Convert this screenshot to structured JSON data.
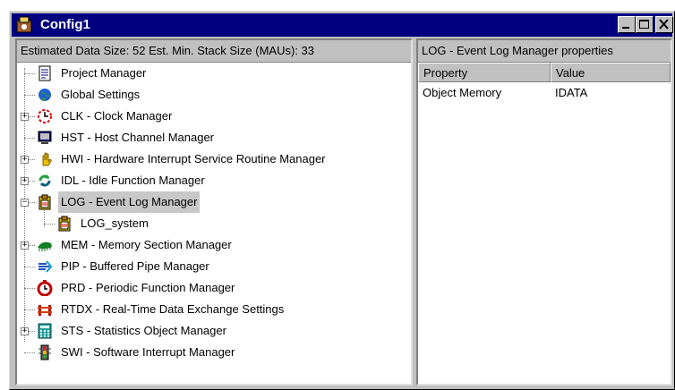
{
  "window": {
    "title": "Config1",
    "controls": {
      "minimize": "minimize",
      "maximize": "maximize",
      "close": "close"
    }
  },
  "left_pane": {
    "header": "Estimated Data Size: 52   Est. Min. Stack Size (MAUs): 33",
    "tree": [
      {
        "label": "Project Manager",
        "icon": "project-manager-icon",
        "expandable": false
      },
      {
        "label": "Global Settings",
        "icon": "globe-icon",
        "expandable": false
      },
      {
        "label": "CLK - Clock Manager",
        "icon": "clock-icon",
        "expandable": true,
        "expanded": false
      },
      {
        "label": "HST - Host Channel Manager",
        "icon": "monitor-icon",
        "expandable": false
      },
      {
        "label": "HWI - Hardware Interrupt Service Routine Manager",
        "icon": "hand-icon",
        "expandable": true,
        "expanded": false
      },
      {
        "label": "IDL - Idle Function Manager",
        "icon": "idle-loop-icon",
        "expandable": true,
        "expanded": false
      },
      {
        "label": "LOG - Event Log Manager",
        "icon": "log-clipboard-icon",
        "expandable": true,
        "expanded": true,
        "selected": true
      },
      {
        "label": "LOG_system",
        "icon": "log-clipboard-icon",
        "expandable": false,
        "child": true
      },
      {
        "label": "MEM - Memory Section Manager",
        "icon": "memory-icon",
        "expandable": true,
        "expanded": false
      },
      {
        "label": "PIP - Buffered Pipe Manager",
        "icon": "pipe-icon",
        "expandable": false
      },
      {
        "label": "PRD - Periodic Function Manager",
        "icon": "periodic-clock-icon",
        "expandable": false
      },
      {
        "label": "RTDX - Real-Time Data Exchange Settings",
        "icon": "rtdx-icon",
        "expandable": false
      },
      {
        "label": "STS - Statistics Object Manager",
        "icon": "calculator-icon",
        "expandable": true,
        "expanded": false
      },
      {
        "label": "SWI - Software Interrupt Manager",
        "icon": "traffic-light-icon",
        "expandable": false
      }
    ]
  },
  "right_pane": {
    "header": "LOG - Event Log Manager properties",
    "columns": [
      "Property",
      "Value"
    ],
    "rows": [
      {
        "property": "Object Memory",
        "value": "IDATA"
      }
    ]
  }
}
